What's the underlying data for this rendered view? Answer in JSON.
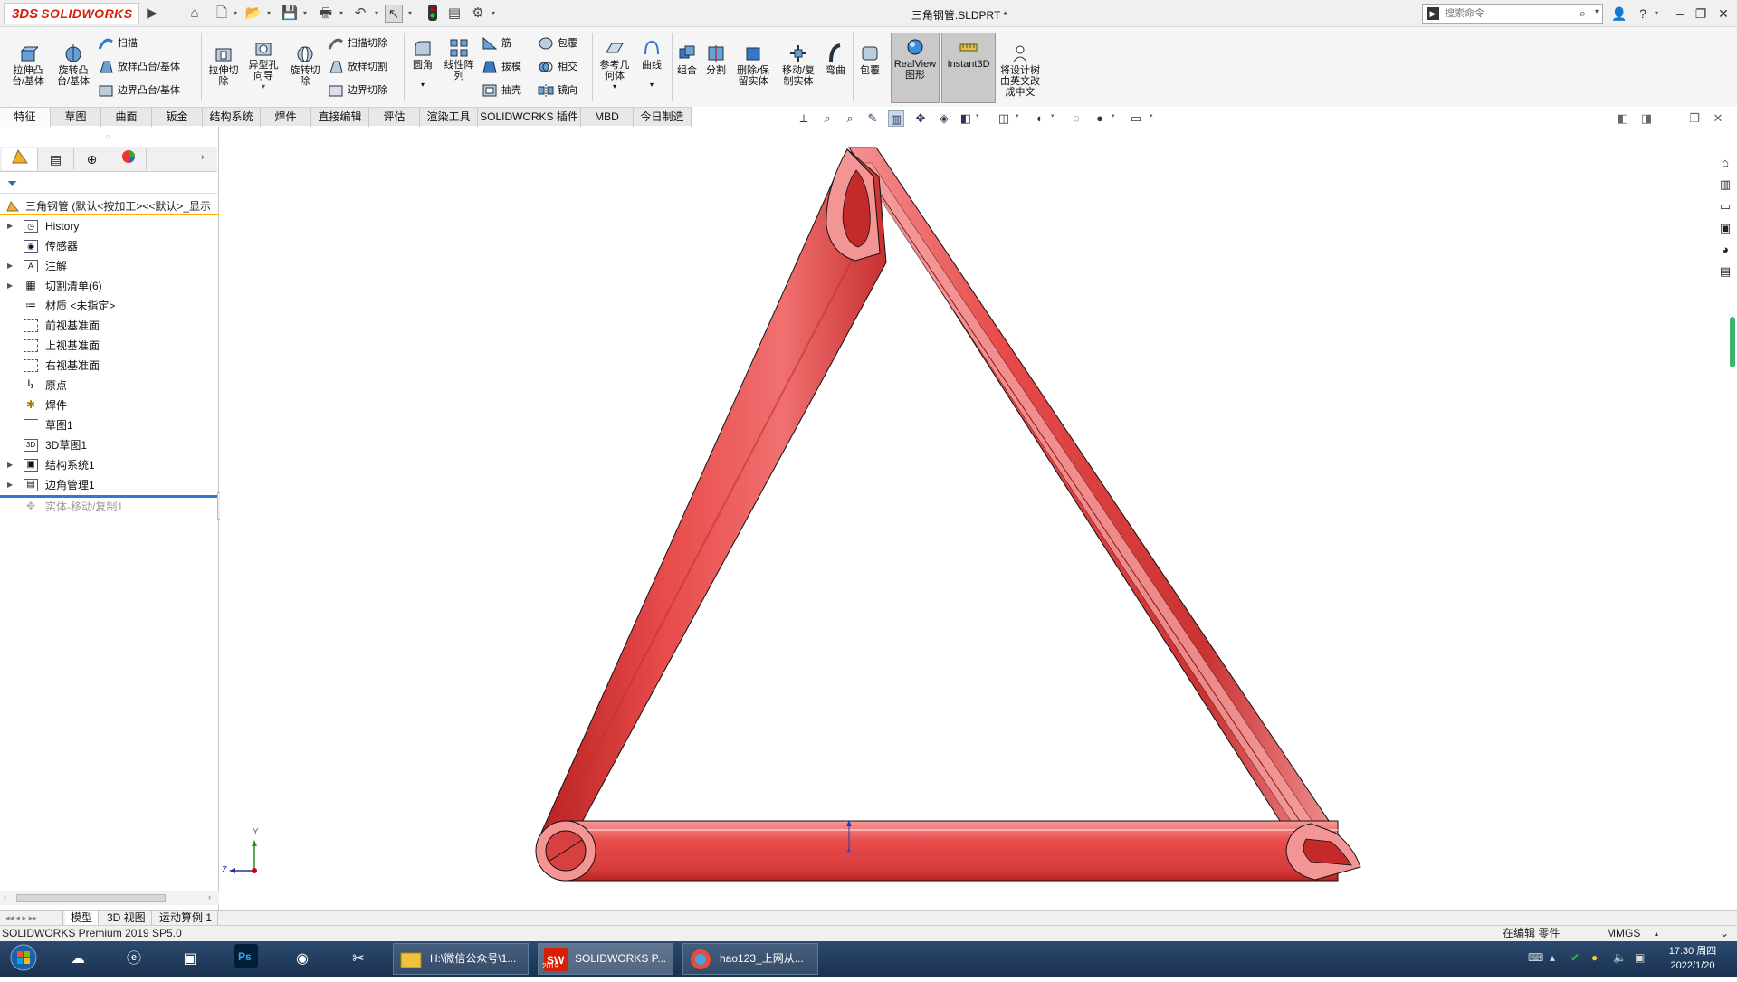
{
  "app": {
    "brand_ds": "3DS",
    "brand_name": "SOLIDWORKS",
    "document_title": "三角钢管.SLDPRT *"
  },
  "search": {
    "placeholder": "搜索命令"
  },
  "commands": {
    "extrude_boss": "拉伸凸\n台/基体",
    "revolve_boss": "旋转凸\n台/基体",
    "sweep": "扫描",
    "loft": "放样凸台/基体",
    "boundary": "边界凸台/基体",
    "extrude_cut": "拉伸切\n除",
    "hole_wizard": "异型孔\n向导",
    "revolve_cut": "旋转切\n除",
    "sweep_cut": "扫描切除",
    "loft_cut": "放样切割",
    "boundary_cut": "边界切除",
    "fillet": "圆角",
    "linear_pattern": "线性阵\n列",
    "rib": "筋",
    "draft": "拔模",
    "shell": "抽壳",
    "wrap": "包覆",
    "intersect": "相交",
    "mirror": "镜向",
    "ref_geometry": "参考几\n何体",
    "curves": "曲线",
    "combine": "组合",
    "split": "分割",
    "delete_keep": "删除/保\n留实体",
    "move_copy": "移动/复\n制实体",
    "flex": "弯曲",
    "wrap2": "包覆",
    "realview": "RealView\n图形",
    "instant3d": "Instant3D",
    "translate_tree": "将设计树\n由英文改\n成中文"
  },
  "tabs": [
    "特征",
    "草图",
    "曲面",
    "钣金",
    "结构系统",
    "焊件",
    "直接编辑",
    "评估",
    "渲染工具",
    "SOLIDWORKS 插件",
    "MBD",
    "今日制造"
  ],
  "feature_tree": {
    "root": "三角钢管 (默认<按加工><<默认>_显示",
    "items": [
      {
        "label": "History",
        "expandable": true
      },
      {
        "label": "传感器",
        "expandable": false
      },
      {
        "label": "注解",
        "expandable": true
      },
      {
        "label": "切割清单(6)",
        "expandable": true
      },
      {
        "label": "材质 <未指定>",
        "expandable": false
      },
      {
        "label": "前视基准面",
        "expandable": false
      },
      {
        "label": "上视基准面",
        "expandable": false
      },
      {
        "label": "右视基准面",
        "expandable": false
      },
      {
        "label": "原点",
        "expandable": false
      },
      {
        "label": "焊件",
        "expandable": false
      },
      {
        "label": "草图1",
        "expandable": false
      },
      {
        "label": "3D草图1",
        "expandable": false
      },
      {
        "label": "结构系统1",
        "expandable": true
      },
      {
        "label": "边角管理1",
        "expandable": true
      },
      {
        "label": "实体-移动/复制1",
        "expandable": false
      }
    ]
  },
  "triad": {
    "y_label": "Y",
    "z_label": "Z"
  },
  "bottom_tabs": [
    "模型",
    "3D 视图",
    "运动算例 1"
  ],
  "status": {
    "product": "SOLIDWORKS Premium 2019 SP5.0",
    "mode": "在编辑 零件",
    "units": "MMGS"
  },
  "taskbar": {
    "tasks": [
      {
        "label": "H:\\微信公众号\\1..."
      },
      {
        "label": "SOLIDWORKS P..."
      },
      {
        "label": "hao123_上网从..."
      }
    ],
    "time": "17:30 周四",
    "date": "2022/1/20",
    "sw_badge": "2019"
  },
  "colors": {
    "brand_red": "#d81e05",
    "tube_red": "#e84a4a",
    "tube_dark": "#b82222",
    "tube_light": "#f59090",
    "rollback_blue": "#2f7ad1",
    "selection_orange": "#ffb000"
  }
}
